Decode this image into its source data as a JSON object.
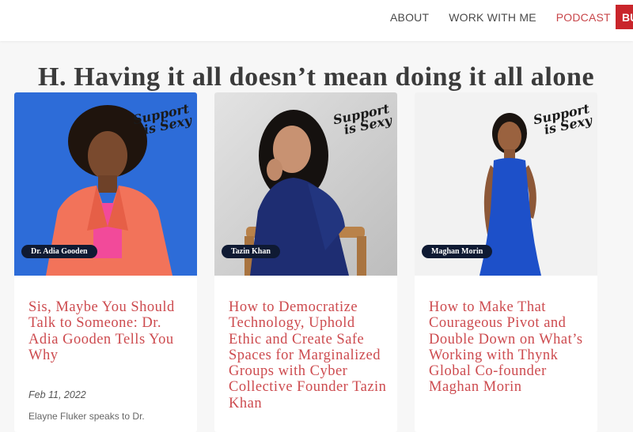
{
  "nav": {
    "items": [
      {
        "label": "ABOUT"
      },
      {
        "label": "WORK WITH ME"
      },
      {
        "label": "PODCAST"
      }
    ],
    "cta_label": "BU",
    "active_color": "#c8464a",
    "cta_color": "#c9252b"
  },
  "heading": "H. Having it all doesn’t mean doing it all alone",
  "cards": [
    {
      "overlay_line1": "Support",
      "overlay_line2": "is Sexy",
      "name_tag": "Dr. Adia Gooden",
      "title": "Sis, Maybe You Should Talk to Someone: Dr. Adia Gooden Tells You Why",
      "date": "Feb 11, 2022",
      "excerpt": "Elayne Fluker speaks to Dr.",
      "bg_color": "#2d6cd8"
    },
    {
      "overlay_line1": "Support",
      "overlay_line2": "is Sexy",
      "name_tag": "Tazin Khan",
      "title": "How to Democratize Technology, Uphold Ethic and Create Safe Spaces for Marginalized Groups with Cyber Collective Founder Tazin Khan",
      "bg_color": "#cfcfcf"
    },
    {
      "overlay_line1": "Support",
      "overlay_line2": "is Sexy",
      "name_tag": "Maghan Morin",
      "title": "How to Make That Courageous Pivot and Double Down on What’s Working with Thynk Global Co-founder Maghan Morin",
      "bg_color": "#f2f2f2"
    }
  ]
}
